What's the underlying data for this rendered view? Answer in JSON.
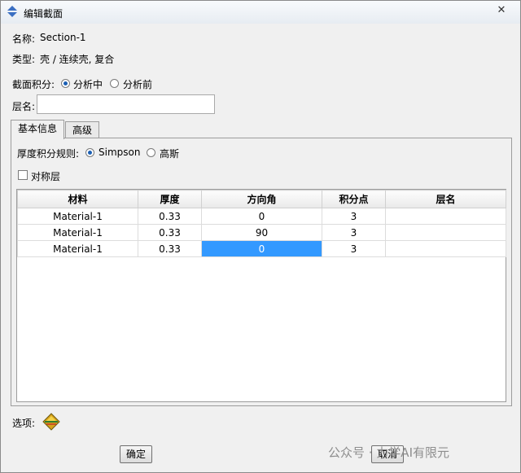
{
  "window": {
    "title": "编辑截面",
    "close_label": "✕"
  },
  "info": {
    "name_label": "名称:",
    "name_value": "Section-1",
    "type_label": "类型:",
    "type_value": "壳 / 连续壳, 复合"
  },
  "integration": {
    "label": "截面积分:",
    "options": [
      {
        "label": "分析中",
        "selected": true
      },
      {
        "label": "分析前",
        "selected": false
      }
    ]
  },
  "layup": {
    "label": "层名:",
    "value": ""
  },
  "tabs": [
    {
      "label": "基本信息",
      "active": true
    },
    {
      "label": "高级",
      "active": false
    }
  ],
  "thickness_rule": {
    "label": "厚度积分规则:",
    "options": [
      {
        "label": "Simpson",
        "selected": true
      },
      {
        "label": "高斯",
        "selected": false
      }
    ]
  },
  "symmetric": {
    "label": "对称层",
    "checked": false
  },
  "table": {
    "columns": [
      "材料",
      "厚度",
      "方向角",
      "积分点",
      "层名"
    ],
    "rows": [
      [
        "Material-1",
        "0.33",
        "0",
        "3",
        ""
      ],
      [
        "Material-1",
        "0.33",
        "90",
        "3",
        ""
      ],
      [
        "Material-1",
        "0.33",
        "0",
        "3",
        ""
      ]
    ],
    "selected_cell": {
      "row": 2,
      "col": 2
    }
  },
  "options_label": "选项:",
  "buttons": {
    "ok": "确定",
    "cancel": "取消"
  },
  "watermark": "公众号 · 力学AI有限元",
  "icons": {
    "title": "edit-section-icon",
    "options": "layer-options-icon"
  }
}
